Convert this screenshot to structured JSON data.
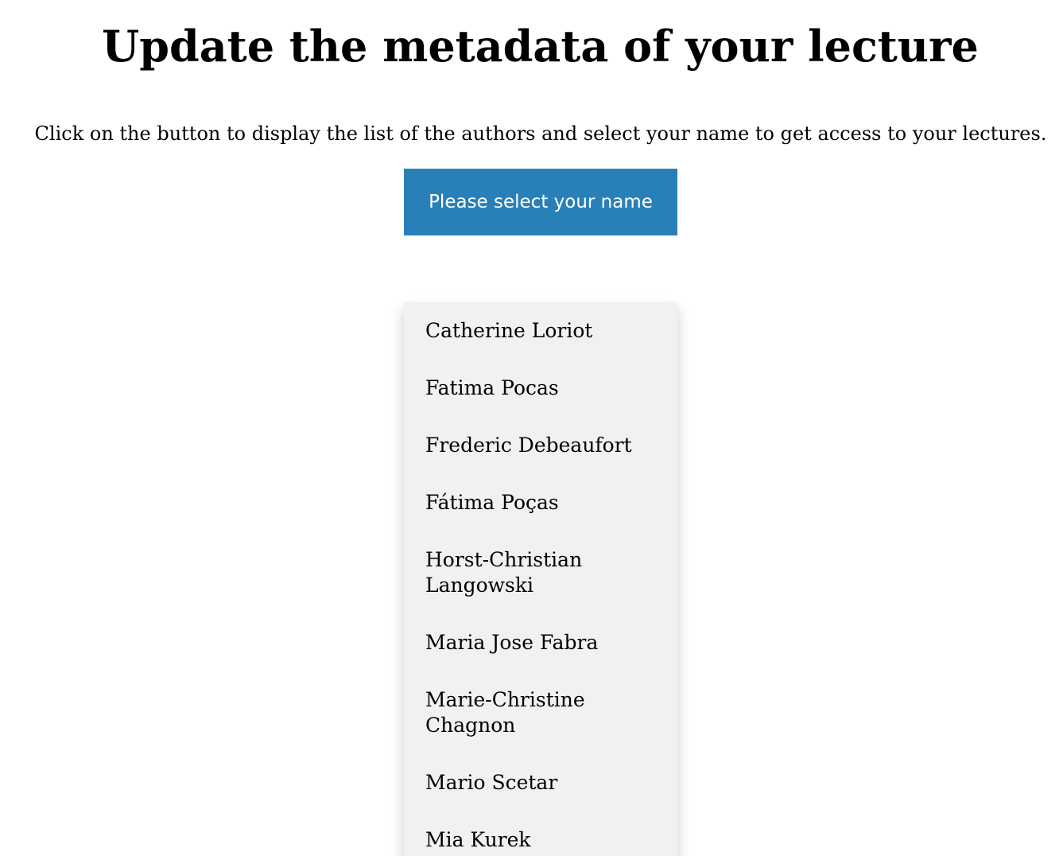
{
  "page": {
    "title": "Update the metadata of your lecture",
    "instruction": "Click on the button to display the list of the authors and select your name to get access to your lectures."
  },
  "dropdown": {
    "button_label": "Please select your name",
    "button_color": "#2980b9",
    "menu_background": "#f1f1f1",
    "items": [
      {
        "label": "Catherine Loriot"
      },
      {
        "label": "Fatima Pocas"
      },
      {
        "label": "Frederic Debeaufort"
      },
      {
        "label": "Fátima Poças"
      },
      {
        "label": "Horst-Christian Langowski"
      },
      {
        "label": "Maria Jose Fabra"
      },
      {
        "label": "Marie-Christine Chagnon"
      },
      {
        "label": "Mario Scetar"
      },
      {
        "label": "Mia Kurek"
      }
    ]
  }
}
